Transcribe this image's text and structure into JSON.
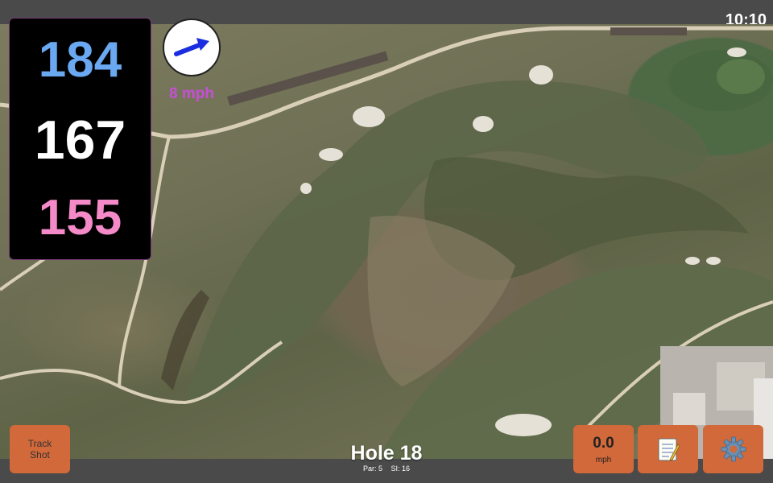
{
  "status": {
    "time": "10:10"
  },
  "distances": {
    "back": "184",
    "middle": "167",
    "front": "155",
    "colors": {
      "back": "#6aa9f2",
      "middle": "#ffffff",
      "front": "#f58ac8"
    }
  },
  "wind": {
    "speed": "8 mph",
    "direction_icon": "wind-arrow-icon",
    "arrow_color": "#1a2ee0"
  },
  "track_shot": {
    "line1": "Track",
    "line2": "Shot"
  },
  "hole": {
    "title": "Hole 18",
    "par": "Par: 5",
    "si": "SI: 16"
  },
  "speed": {
    "value": "0.0",
    "unit": "mph"
  },
  "icons": {
    "notes": "notepad-icon",
    "settings": "gear-icon"
  },
  "colors": {
    "accent_button": "#d2693a",
    "wind_text": "#c64fd6"
  }
}
